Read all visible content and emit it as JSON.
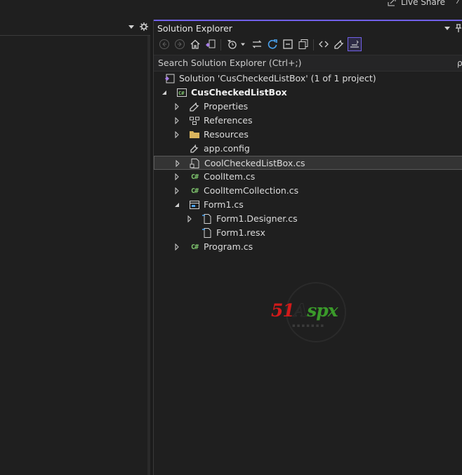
{
  "top": {
    "live_share_label": "Live Share"
  },
  "solution_explorer": {
    "title": "Solution Explorer",
    "search_placeholder": "Search Solution Explorer (Ctrl+;)",
    "toolbar_icons": [
      "back-icon",
      "forward-icon",
      "home-icon",
      "switch-views-icon",
      "pending-changes-filter-icon",
      "dropdown-icon",
      "sync-active-document-icon",
      "refresh-icon",
      "collapse-all-icon",
      "show-all-files-icon",
      "view-code-icon",
      "properties-icon",
      "preview-selected-items-icon"
    ],
    "tree": [
      {
        "label": "Solution 'CusCheckedListBox' (1 of 1 project)",
        "icon": "solution-icon",
        "expander": "none",
        "level": 0,
        "bold": false,
        "selected": false
      },
      {
        "label": "CusCheckedListBox",
        "icon": "csharp-project-icon",
        "expander": "expanded",
        "level": 0,
        "bold": true,
        "selected": false
      },
      {
        "label": "Properties",
        "icon": "wrench-icon",
        "expander": "collapsed",
        "level": 1,
        "bold": false,
        "selected": false
      },
      {
        "label": "References",
        "icon": "references-icon",
        "expander": "collapsed",
        "level": 1,
        "bold": false,
        "selected": false
      },
      {
        "label": "Resources",
        "icon": "folder-icon",
        "expander": "collapsed",
        "level": 1,
        "bold": false,
        "selected": false
      },
      {
        "label": "app.config",
        "icon": "config-file-icon",
        "expander": "none",
        "level": 1,
        "bold": false,
        "selected": false
      },
      {
        "label": "CoolCheckedListBox.cs",
        "icon": "component-file-icon",
        "expander": "collapsed",
        "level": 1,
        "bold": false,
        "selected": true
      },
      {
        "label": "CoolItem.cs",
        "icon": "csharp-file-icon",
        "expander": "collapsed",
        "level": 1,
        "bold": false,
        "selected": false
      },
      {
        "label": "CoolItemCollection.cs",
        "icon": "csharp-file-icon",
        "expander": "collapsed",
        "level": 1,
        "bold": false,
        "selected": false
      },
      {
        "label": "Form1.cs",
        "icon": "form-icon",
        "expander": "expanded",
        "level": 1,
        "bold": false,
        "selected": false
      },
      {
        "label": "Form1.Designer.cs",
        "icon": "designer-file-icon",
        "expander": "collapsed",
        "level": 2,
        "bold": false,
        "selected": false
      },
      {
        "label": "Form1.resx",
        "icon": "resx-file-icon",
        "expander": "none",
        "level": 2,
        "bold": false,
        "selected": false
      },
      {
        "label": "Program.cs",
        "icon": "csharp-file-icon",
        "expander": "collapsed",
        "level": 1,
        "bold": false,
        "selected": false
      }
    ]
  },
  "watermark": {
    "brand_part1": "51",
    "brand_part2": "A",
    "brand_part3": "spx"
  },
  "colors": {
    "accent": "#7160e8",
    "csharp": "#7ec46d",
    "background": "#1f1f1f",
    "selected_row": "#343434"
  }
}
